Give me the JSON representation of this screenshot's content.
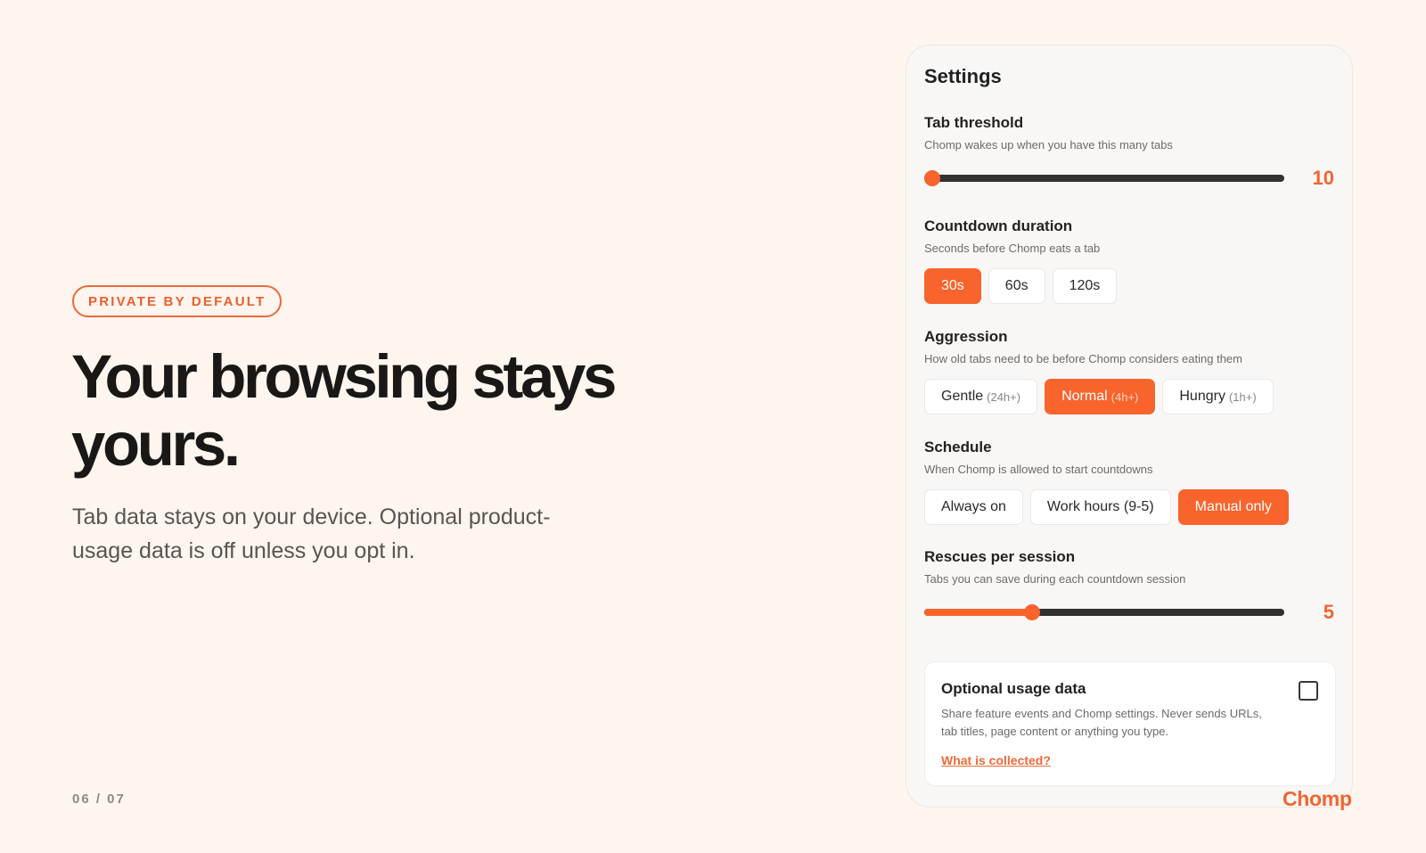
{
  "hero": {
    "badge": "PRIVATE BY DEFAULT",
    "headline": "Your browsing stays yours.",
    "subtext": "Tab data stays on your device. Optional product-usage data is off unless you opt in.",
    "pager": "06 / 07"
  },
  "settings": {
    "title": "Settings",
    "tab_threshold": {
      "title": "Tab threshold",
      "description": "Chomp wakes up when you have this many tabs",
      "value": "10",
      "fill_fraction": 0.0
    },
    "countdown": {
      "title": "Countdown duration",
      "description": "Seconds before Chomp eats a tab",
      "options": [
        {
          "label": "30s",
          "active": true
        },
        {
          "label": "60s",
          "active": false
        },
        {
          "label": "120s",
          "active": false
        }
      ]
    },
    "aggression": {
      "title": "Aggression",
      "description": "How old tabs need to be before Chomp considers eating them",
      "options": [
        {
          "label": "Gentle",
          "sub": "(24h+)",
          "active": false
        },
        {
          "label": "Normal",
          "sub": "(4h+)",
          "active": true
        },
        {
          "label": "Hungry",
          "sub": "(1h+)",
          "active": false
        }
      ]
    },
    "schedule": {
      "title": "Schedule",
      "description": "When Chomp is allowed to start countdowns",
      "options": [
        {
          "label": "Always on",
          "active": false
        },
        {
          "label": "Work hours (9-5)",
          "active": false
        },
        {
          "label": "Manual only",
          "active": true
        }
      ]
    },
    "rescues": {
      "title": "Rescues per session",
      "description": "Tabs you can save during each countdown session",
      "value": "5",
      "fill_fraction": 0.3
    },
    "usage": {
      "title": "Optional usage data",
      "description": "Share feature events and Chomp settings. Never sends URLs, tab titles, page content or anything you type.",
      "link": "What is collected?",
      "checked": false
    }
  },
  "brand": "Chomp",
  "colors": {
    "accent": "#f8642c",
    "background": "#fdf5ee",
    "card": "#f8f7f6"
  }
}
